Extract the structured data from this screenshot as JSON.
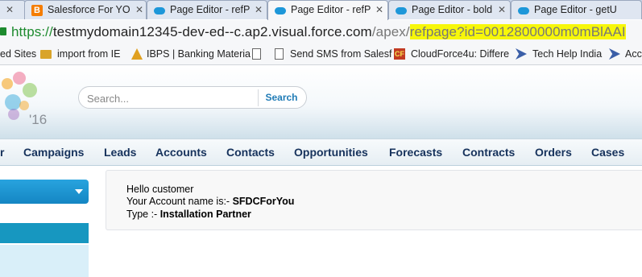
{
  "browser": {
    "tabs": [
      {
        "title": "Salesforce For YO",
        "icon": "blogger-icon",
        "active": false
      },
      {
        "title": "Page Editor - refP",
        "icon": "salesforce-cloud-icon",
        "active": false
      },
      {
        "title": "Page Editor - refP",
        "icon": "salesforce-cloud-icon",
        "active": true
      },
      {
        "title": "Page Editor - bold",
        "icon": "salesforce-cloud-icon",
        "active": false
      },
      {
        "title": "Page Editor - getU",
        "icon": "salesforce-cloud-icon",
        "active": false
      }
    ],
    "close_glyph": "✕",
    "address": {
      "protocol": "https://",
      "host": "testmydomain12345-dev-ed--c.ap2.visual.force.com",
      "path": "/apex/",
      "query": "refpage?id=0012800000m0mBlAAI"
    },
    "bookmarks": [
      {
        "label": "ed Sites",
        "icon": ""
      },
      {
        "label": "import from IE",
        "icon": "folder-icon"
      },
      {
        "label": "IBPS | Banking Materia",
        "icon": "ibps-icon"
      },
      {
        "label": "",
        "icon": "page-icon"
      },
      {
        "label": "Send SMS from Salesf",
        "icon": "page-icon"
      },
      {
        "label": "CloudForce4u: Differe",
        "icon": "cloudforce-icon"
      },
      {
        "label": "Tech Help India",
        "icon": "arrow-icon"
      },
      {
        "label": "Acc",
        "icon": "arrow-icon"
      }
    ]
  },
  "header": {
    "logo_year": "'16",
    "search": {
      "placeholder": "Search...",
      "button_label": "Search"
    }
  },
  "nav": {
    "tabs": [
      "r",
      "Campaigns",
      "Leads",
      "Accounts",
      "Contacts",
      "Opportunities",
      "Forecasts",
      "Contracts",
      "Orders",
      "Cases"
    ]
  },
  "content": {
    "greeting": "Hello customer",
    "account_label": "Your Account name is:- ",
    "account_name": "SFDCForYou",
    "type_label": "Type :- ",
    "type_value": "Installation Partner"
  },
  "colors": {
    "accent": "#1797c0",
    "nav_text": "#16325c",
    "url_highlight": "#f7f70a",
    "secure_green": "#1d8a2e"
  }
}
